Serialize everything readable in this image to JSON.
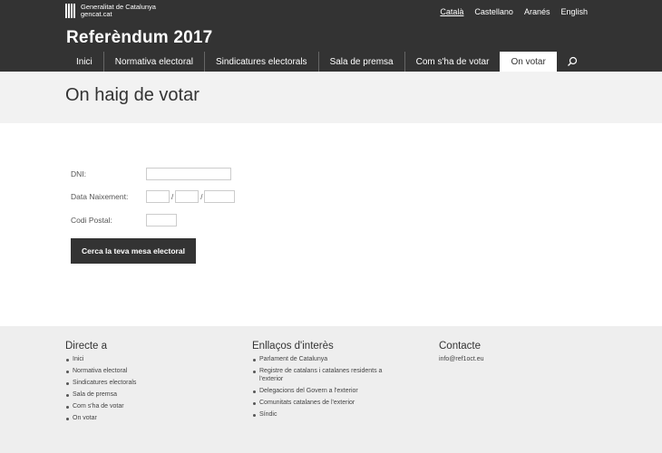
{
  "header": {
    "gov_name_line1": "Generalitat de Catalunya",
    "gov_name_line2": "gencat.cat",
    "languages": [
      "Català",
      "Castellano",
      "Aranés",
      "English"
    ],
    "active_language": "Català",
    "site_title": "Referèndum 2017",
    "nav": [
      "Inici",
      "Normativa electoral",
      "Sindicatures electorals",
      "Sala de premsa",
      "Com s'ha de votar",
      "On votar"
    ],
    "active_nav": "On votar",
    "search_icon": "search-icon"
  },
  "page": {
    "title": "On haig de votar"
  },
  "form": {
    "dni_label": "DNI:",
    "birthdate_label": "Data Naixement:",
    "date_separator": "/",
    "postal_label": "Codi Postal:",
    "dni_value": "",
    "day_value": "",
    "month_value": "",
    "year_value": "",
    "postal_value": "",
    "submit_label": "Cerca la teva mesa electoral"
  },
  "footer": {
    "direct_title": "Directe a",
    "direct_links": [
      "Inici",
      "Normativa electoral",
      "Sindicatures electorals",
      "Sala de premsa",
      "Com s'ha de votar",
      "On votar"
    ],
    "links_title": "Enllaços d'interès",
    "interest_links": [
      "Parlament de Catalunya",
      "Registre de catalans i catalanes residents a l'exterior",
      "Delegacions del Govern a l'exterior",
      "Comunitats catalanes de l'exterior",
      "Síndic"
    ],
    "contact_title": "Contacte",
    "contact_email": "info@ref1oct.eu"
  },
  "colors": {
    "header_bg": "#333333",
    "title_band_bg": "#f2f2f2",
    "footer_bg": "#eeeeee",
    "button_bg": "#333333"
  }
}
